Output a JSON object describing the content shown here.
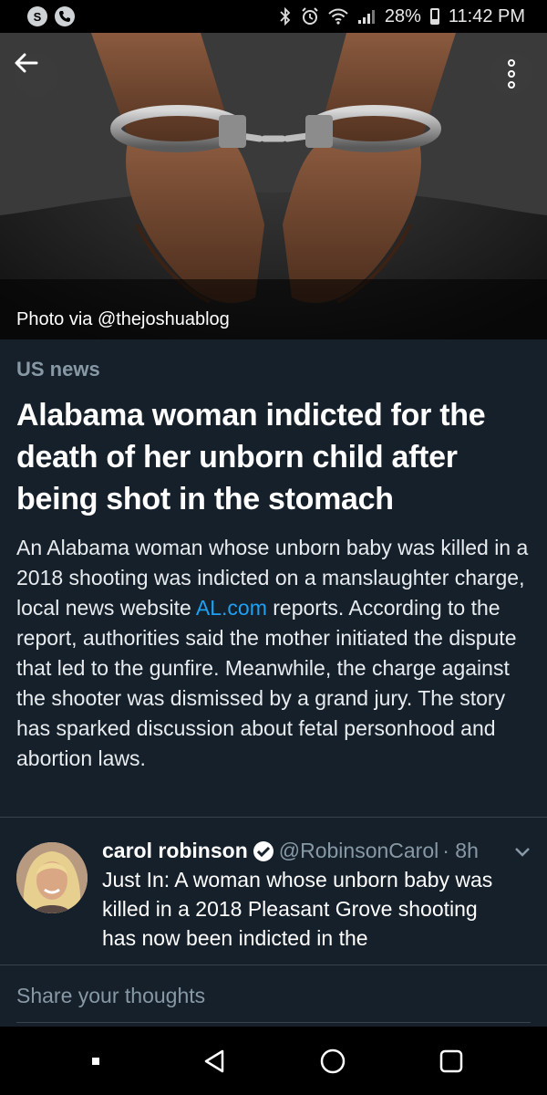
{
  "status_bar": {
    "left_icons": [
      "skype-icon",
      "phone-call-icon"
    ],
    "skype_letter": "S",
    "battery": "28%",
    "time": "11:42 PM"
  },
  "hero": {
    "photo_credit": "Photo via @thejoshuablog",
    "image_subject": "handcuffed-hands"
  },
  "article": {
    "category": "US news",
    "headline": "Alabama woman indicted for the death of her unborn child after being shot in the stomach",
    "summary_before_link": "An Alabama woman whose unborn baby was killed in a 2018 shooting was indicted on a manslaughter charge, local news website ",
    "summary_link": "AL.com",
    "summary_after_link": " reports. According to the report, authorities said the mother initiated the dispute that led to the gunfire. Meanwhile, the charge against the shooter was dismissed by a grand jury. The story has sparked discussion about fetal personhood and abortion laws."
  },
  "tweet": {
    "name": "carol robinson",
    "handle": "@RobinsonCarol",
    "time": "· 8h",
    "text": "Just In: A woman whose unborn baby was killed in a 2018 Pleasant Grove shooting has now been indicted in the"
  },
  "reply": {
    "placeholder": "Share your thoughts"
  },
  "colors": {
    "background": "#15202b",
    "link": "#1da1f2",
    "muted": "#8899a6",
    "divider": "#38444d"
  }
}
